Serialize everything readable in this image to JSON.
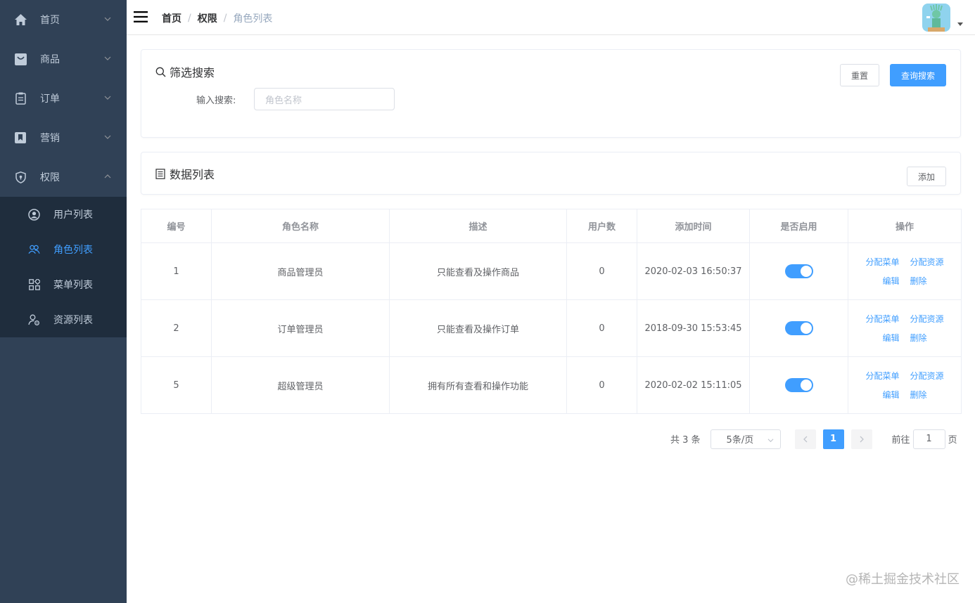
{
  "sidebar": {
    "items": [
      {
        "label": "首页",
        "icon": "home-icon"
      },
      {
        "label": "商品",
        "icon": "bag-icon"
      },
      {
        "label": "订单",
        "icon": "clipboard-icon"
      },
      {
        "label": "营销",
        "icon": "bookmark-icon"
      },
      {
        "label": "权限",
        "icon": "shield-icon"
      }
    ],
    "subitems": [
      {
        "label": "用户列表",
        "icon": "user-circle-icon"
      },
      {
        "label": "角色列表",
        "icon": "users-icon",
        "active": true
      },
      {
        "label": "菜单列表",
        "icon": "grid-icon"
      },
      {
        "label": "资源列表",
        "icon": "user-settings-icon"
      }
    ]
  },
  "breadcrumb": {
    "home": "首页",
    "section": "权限",
    "current": "角色列表",
    "separator": "/"
  },
  "filter": {
    "title": "筛选搜索",
    "label": "输入搜索:",
    "placeholder": "角色名称",
    "reset_label": "重置",
    "search_label": "查询搜索"
  },
  "list": {
    "title": "数据列表",
    "add_label": "添加"
  },
  "table": {
    "headers": [
      "编号",
      "角色名称",
      "描述",
      "用户数",
      "添加时间",
      "是否启用",
      "操作"
    ],
    "rows": [
      {
        "id": "1",
        "name": "商品管理员",
        "desc": "只能查看及操作商品",
        "users": "0",
        "time": "2020-02-03 16:50:37",
        "enabled": true
      },
      {
        "id": "2",
        "name": "订单管理员",
        "desc": "只能查看及操作订单",
        "users": "0",
        "time": "2018-09-30 15:53:45",
        "enabled": true
      },
      {
        "id": "5",
        "name": "超级管理员",
        "desc": "拥有所有查看和操作功能",
        "users": "0",
        "time": "2020-02-02 15:11:05",
        "enabled": true
      }
    ],
    "ops": {
      "assign_menu": "分配菜单",
      "assign_resource": "分配资源",
      "edit": "编辑",
      "delete": "删除"
    }
  },
  "pagination": {
    "total": "共 3 条",
    "page_size": "5条/页",
    "current": "1",
    "goto": "前往",
    "goto_value": "1",
    "page_suffix": "页"
  },
  "watermark": "@稀土掘金技术社区",
  "colors": {
    "sidebar": "#304156",
    "submenu": "#1f2d3d",
    "accent": "#409eff"
  }
}
